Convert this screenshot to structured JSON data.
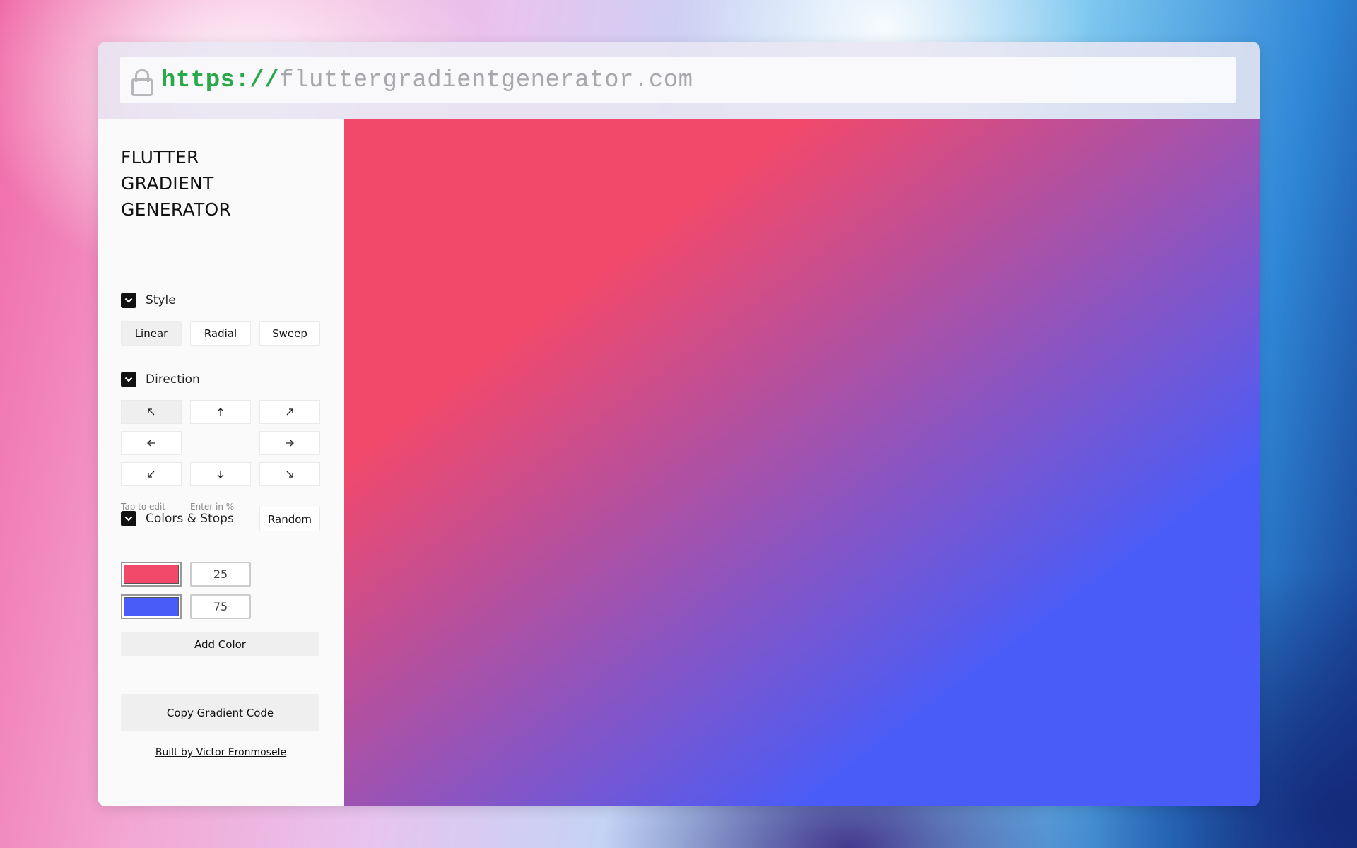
{
  "browser": {
    "url_scheme": "https://",
    "url_host": "fluttergradientgenerator.com"
  },
  "sidebar": {
    "title_lines": [
      "FLUTTER",
      "GRADIENT",
      "GENERATOR"
    ],
    "style_section": {
      "label": "Style",
      "options": [
        "Linear",
        "Radial",
        "Sweep"
      ],
      "selected": "Linear"
    },
    "direction_section": {
      "label": "Direction",
      "options": [
        "top-left",
        "top",
        "top-right",
        "left",
        "right",
        "bottom-left",
        "bottom",
        "bottom-right"
      ],
      "selected": "top-left"
    },
    "colors_section": {
      "label": "Colors & Stops",
      "random_label": "Random",
      "color_hint": "Tap to edit",
      "stop_hint": "Enter in %",
      "stops": [
        {
          "color": "#f2496b",
          "stop": "25"
        },
        {
          "color": "#4a5cf7",
          "stop": "75"
        }
      ],
      "add_color_label": "Add Color"
    },
    "copy_button_label": "Copy Gradient Code",
    "footer": "Built by Victor Eronmosele"
  },
  "preview": {
    "style": "linear",
    "direction": "top-left to bottom-right",
    "colors": [
      "#f2496b",
      "#4a5cf7"
    ],
    "stops_percent": [
      25,
      75
    ]
  }
}
